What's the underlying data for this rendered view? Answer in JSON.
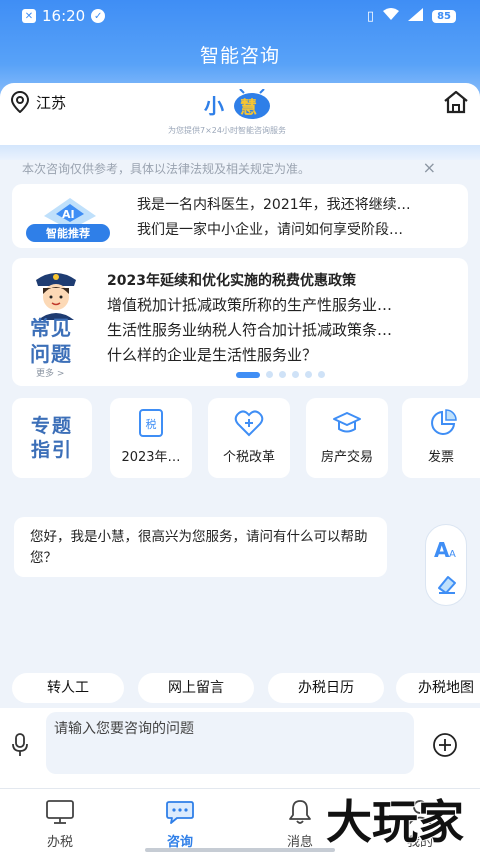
{
  "status_bar": {
    "time": "16:20",
    "battery": "85"
  },
  "title": "智能咨询",
  "header": {
    "location": "江苏",
    "logo_text": "小慧",
    "tagline": "为您提供7×24小时智能咨询服务"
  },
  "notice": {
    "text": "本次咨询仅供参考，具体以法律法规及相关规定为准。",
    "close": "×"
  },
  "ai_recommend": {
    "badge": "智能推荐",
    "questions": [
      "我是一名内科医生，2021年，我还将继续…",
      "我们是一家中小企业，请问如何享受阶段…"
    ]
  },
  "faq": {
    "label_line1": "常见",
    "label_line2": "问题",
    "more": "更多 >",
    "title": "2023年延续和优化实施的税费优惠政策",
    "items": [
      "增值税加计抵减政策所称的生产性服务业…",
      "生活性服务业纳税人符合加计抵减政策条…",
      "什么样的企业是生活性服务业？"
    ]
  },
  "topics": {
    "label_line1": "专题",
    "label_line2": "指引",
    "items": [
      {
        "label": "2023年…",
        "icon": "tax-doc-icon"
      },
      {
        "label": "个税改革",
        "icon": "heart-plus-icon"
      },
      {
        "label": "房产交易",
        "icon": "graduation-cap-icon"
      },
      {
        "label": "发票",
        "icon": "pie-chart-icon"
      }
    ]
  },
  "chat": {
    "greeting": "您好，我是小慧，很高兴为您服务，请问有什么可以帮助您？"
  },
  "quick_actions": [
    "转人工",
    "网上留言",
    "办税日历",
    "办税地图"
  ],
  "input": {
    "placeholder": "请输入您要咨询的问题"
  },
  "tabbar": [
    {
      "label": "办税",
      "icon": "monitor-icon",
      "active": false
    },
    {
      "label": "咨询",
      "icon": "chat-bubble-icon",
      "active": true
    },
    {
      "label": "消息",
      "icon": "bell-icon",
      "active": false
    },
    {
      "label": "我的",
      "icon": "user-icon",
      "active": false
    }
  ],
  "watermark": "大玩家",
  "colors": {
    "primary": "#3f8ef5",
    "label_blue": "#3c6fb8",
    "background": "#eef3fa"
  }
}
